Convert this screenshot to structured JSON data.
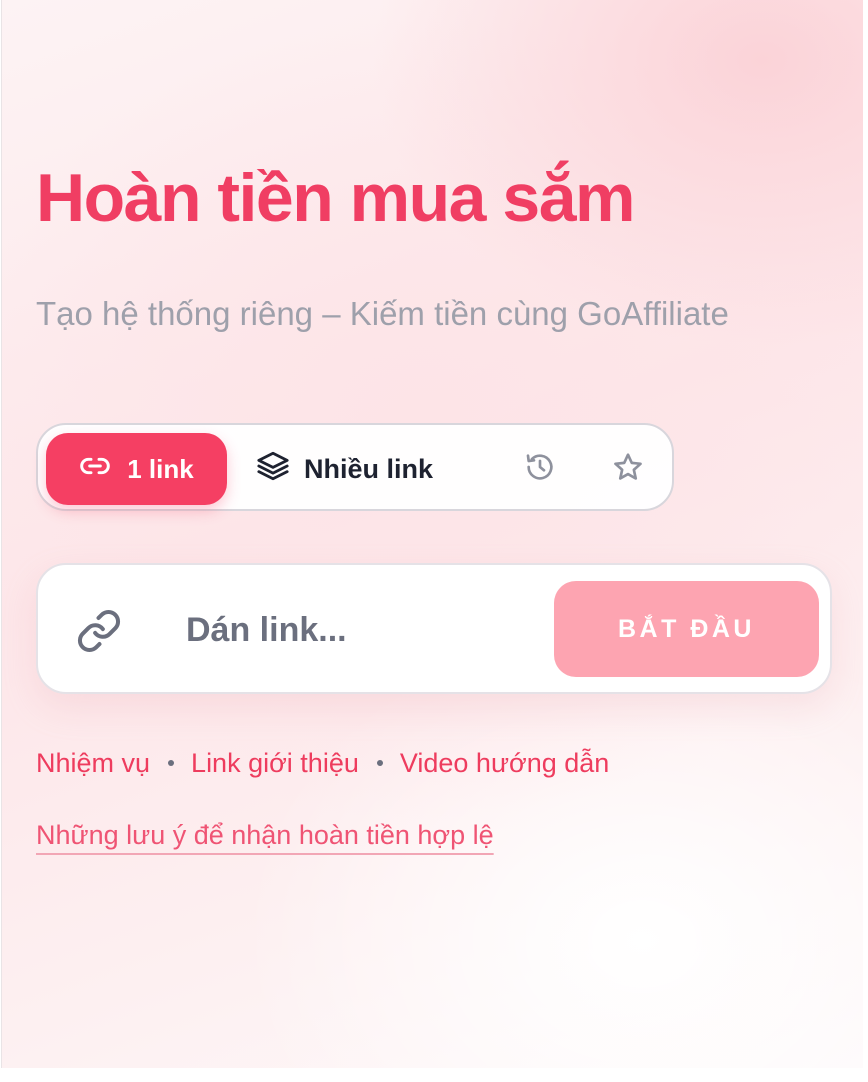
{
  "hero": {
    "title": "Hoàn tiền mua sắm",
    "subtitle": "Tạo hệ thống riêng – Kiếm tiền cùng GoAffiliate"
  },
  "mode_tabs": {
    "single": {
      "label": "1 link",
      "icon": "link-icon",
      "active": true
    },
    "multi": {
      "label": "Nhiều link",
      "icon": "layers-icon",
      "active": false
    },
    "history_icon": "history-icon",
    "favorites_icon": "star-icon"
  },
  "link_form": {
    "input_icon": "link-icon",
    "placeholder": "Dán link...",
    "value": "",
    "submit_label": "BẮT ĐẦU"
  },
  "quick_links": [
    {
      "label": "Nhiệm vụ"
    },
    {
      "label": "Link giới thiệu"
    },
    {
      "label": "Video hướng dẫn"
    }
  ],
  "notes_link": "Những lưu ý để nhận hoàn tiền hợp lệ",
  "colors": {
    "accent": "#f53f63",
    "accent_light": "#fda4b1",
    "title": "#f03e63",
    "subtitle": "#9ea0ab",
    "text_dark": "#1e2230"
  }
}
